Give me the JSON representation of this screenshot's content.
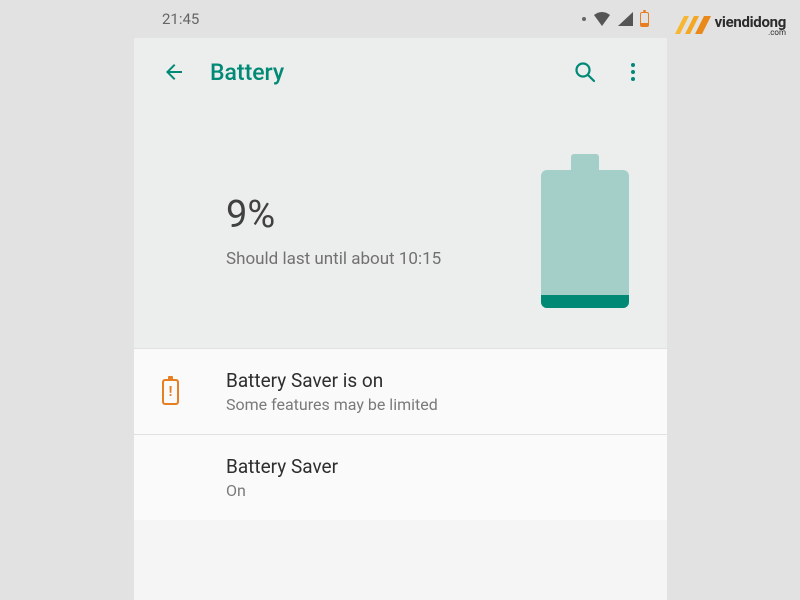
{
  "status_bar": {
    "time": "21:45"
  },
  "app_bar": {
    "title": "Battery"
  },
  "hero": {
    "percentage": "9%",
    "estimate": "Should last until about 10:15",
    "battery_level_percent": 9
  },
  "items": {
    "saver_notice": {
      "title": "Battery Saver is on",
      "subtitle": "Some features may be limited"
    },
    "saver_setting": {
      "title": "Battery Saver",
      "subtitle": "On"
    }
  },
  "watermark": {
    "brand": "viendidong",
    "suffix": ".com"
  },
  "colors": {
    "accent": "#008a76",
    "battery_light": "#a4cfc8",
    "warning": "#e67e22"
  }
}
